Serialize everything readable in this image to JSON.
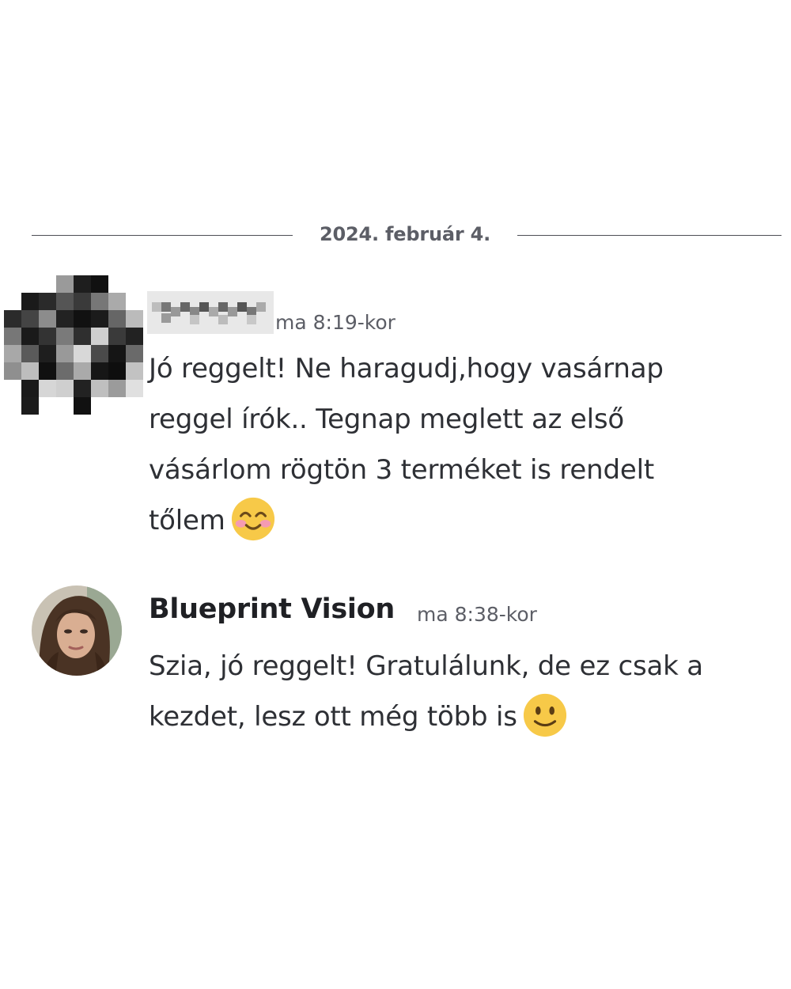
{
  "divider": {
    "date": "2024. február 4."
  },
  "messages": [
    {
      "author": "",
      "author_obscured": true,
      "timestamp": "ma 8:19-kor",
      "lines": [
        "Jó reggelt! Ne haragudj,hogy vasárnap",
        "reggel írók.. Tegnap meglett az első",
        "vásárlom rögtön 3 terméket is rendelt",
        "tőlem"
      ],
      "emoji": "smiling-face-with-smiling-eyes-emoji"
    },
    {
      "author": "Blueprint Vision",
      "timestamp": "ma 8:38-kor",
      "lines": [
        "Szia, jó reggelt! Gratulálunk, de ez csak a",
        "kezdet, lesz ott még több is"
      ],
      "emoji": "slightly-smiling-face-emoji"
    }
  ],
  "colors": {
    "background": "#ffffff",
    "text": "#2e3035",
    "muted": "#5c5e66",
    "emoji_yellow": "#f7c948"
  }
}
